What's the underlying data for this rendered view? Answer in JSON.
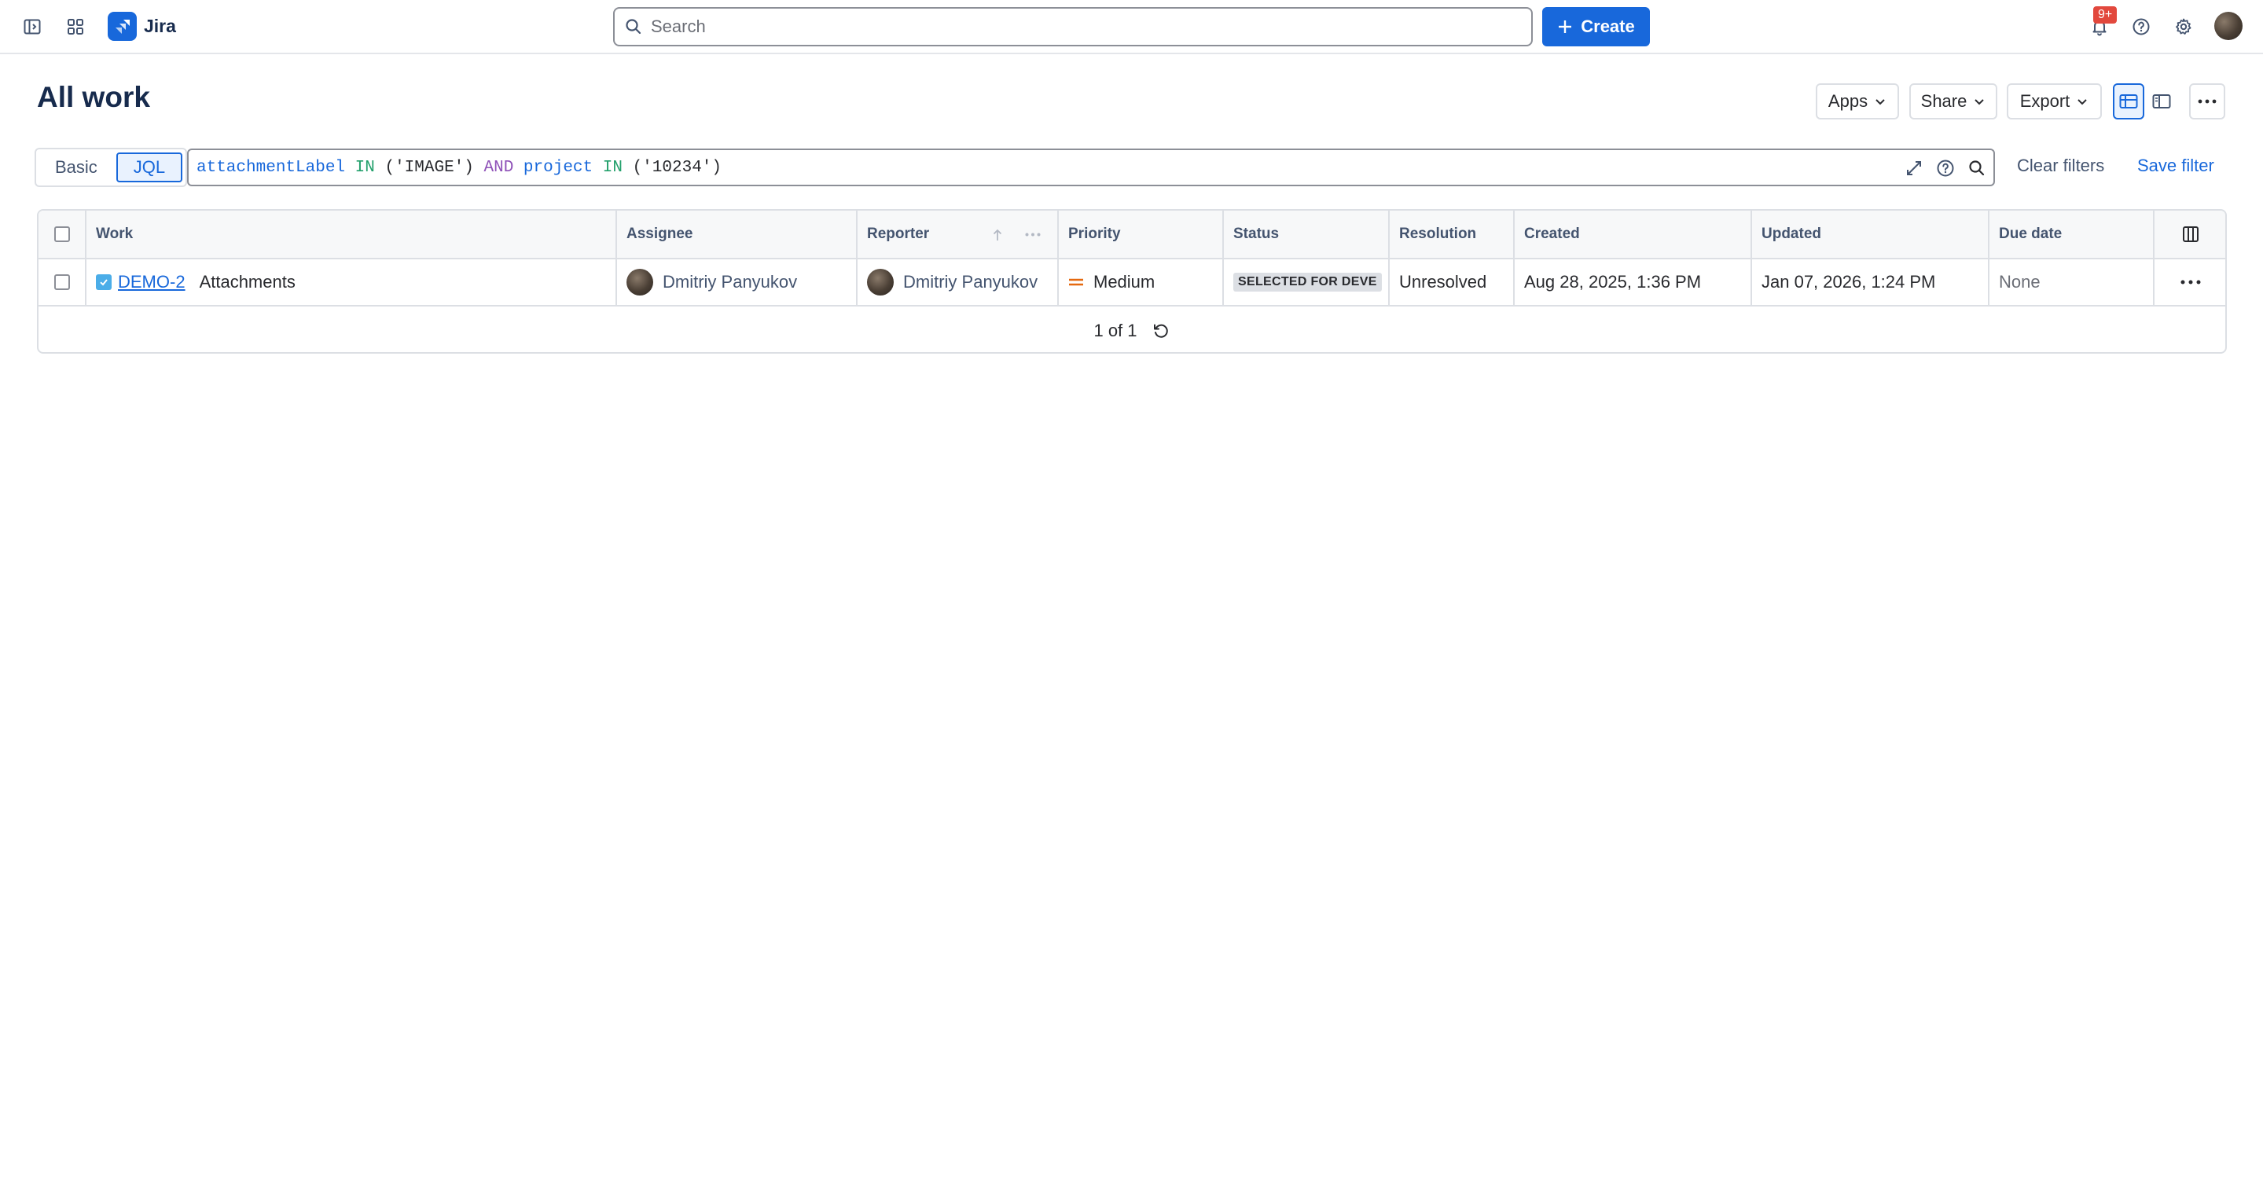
{
  "app": {
    "name": "Jira"
  },
  "topnav": {
    "search_placeholder": "Search",
    "create_label": "Create",
    "notification_count": "9+"
  },
  "page": {
    "title": "All work",
    "buttons": {
      "apps": "Apps",
      "share": "Share",
      "export": "Export"
    }
  },
  "filter": {
    "modes": [
      "Basic",
      "JQL"
    ],
    "active_mode": "JQL",
    "jql_tokens": {
      "field1": "attachmentLabel",
      "op1": "IN",
      "val1": "('IMAGE')",
      "and": "AND",
      "field2": "project",
      "op2": "IN",
      "val2": "('10234')"
    },
    "clear_label": "Clear filters",
    "save_label": "Save filter"
  },
  "table": {
    "columns": {
      "work": "Work",
      "assignee": "Assignee",
      "reporter": "Reporter",
      "priority": "Priority",
      "status": "Status",
      "resolution": "Resolution",
      "created": "Created",
      "updated": "Updated",
      "due_date": "Due date"
    },
    "rows": [
      {
        "key": "DEMO-2",
        "summary": "Attachments",
        "assignee": "Dmitriy Panyukov",
        "reporter": "Dmitriy Panyukov",
        "priority": "Medium",
        "status": "SELECTED FOR DEVE",
        "resolution": "Unresolved",
        "created": "Aug 28, 2025, 1:36 PM",
        "updated": "Jan 07, 2026, 1:24 PM",
        "due_date": "None"
      }
    ],
    "pagination": "1 of 1"
  },
  "colors": {
    "brand": "#1868db",
    "priority_medium": "#e56910",
    "badge": "#e2483d"
  }
}
